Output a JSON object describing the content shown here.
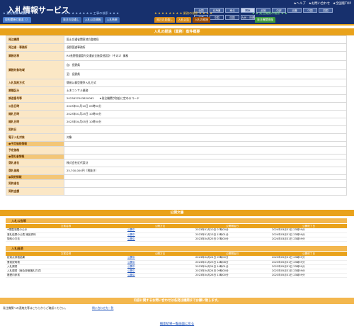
{
  "header": {
    "title": "入札情報サービス",
    "links": [
      "★ヘルプ",
      "★お問い合わせ",
      "★全国版TOP"
    ],
    "regions_row1": [
      "全国",
      "北海道",
      "東北",
      "関東",
      "北陸",
      "中部",
      "近畿",
      "中国",
      "四国",
      "九州・沖縄"
    ],
    "regions_row2": [
      "沖縄",
      "中国",
      "四国",
      "九州・沖縄"
    ],
    "selected_region": "関東",
    "groups": [
      {
        "title": "★ 契約関係の検索 ★",
        "tabs": [
          "契約関係の案本（）"
        ]
      },
      {
        "title": "★ ★ ★ ★ ★ ★ ★ ★ ★ 工事の検索 ★ ★ ★",
        "tabs": [
          "発注の見通し",
          "入札公告情報",
          "入札結果"
        ]
      },
      {
        "title": "★ ★ ★ ★ ★ ★ ★ ★ 業務の検索 ★ ★ ★ ★",
        "tabs": [
          "発注の見通し",
          "入札公告",
          "入札の経過"
        ]
      },
      {
        "title": "★ ★ 発注機関の検索 ★ ★",
        "tabs": [
          "発注機関情報"
        ]
      }
    ]
  },
  "main": {
    "title": "入札の経過（業務）案件概要",
    "rows": [
      {
        "label": "発注機関",
        "value": "国土交通省関東地方整備局"
      },
      {
        "label": "発注者・事務所",
        "value": "長野国道事務所"
      },
      {
        "label": "業務名称",
        "value": "R5長野国道管内交通安全施設他設計（その2）業務"
      },
      {
        "label": "業務対象地域",
        "value": "自：長野県"
      },
      {
        "label": "",
        "value": "至：長野県"
      },
      {
        "label": "入札契約方式",
        "value": "簡易公募型競争入札方式"
      },
      {
        "label": "業種区分",
        "value": "土木コンサル業務"
      },
      {
        "label": "調達番号等",
        "value": "2023837003820062　　★発注機関が独自に定めるコード"
      },
      {
        "label": "公告日時",
        "value": "2023年01月10日 09時00分"
      },
      {
        "label": "開札日時",
        "value": "2023年01月25日 10時00分"
      },
      {
        "label": "開札日時",
        "value": "2023年04月05日 10時00分"
      },
      {
        "label": "契約日",
        "value": ""
      },
      {
        "label": "電子入札対象",
        "value": "対象"
      }
    ],
    "sub1": "●予定価格情報",
    "sub1_rows": [
      {
        "label": "予定価格",
        "value": ""
      }
    ],
    "sub2": "●落札者情報",
    "sub2_rows": [
      {
        "label": "落札者名",
        "value": "株式会社近代設計"
      },
      {
        "label": "落札価格",
        "value": "25,700,000円（税抜き）"
      }
    ],
    "sub3": "●契約情報",
    "sub3_rows": [
      {
        "label": "契約者名",
        "value": ""
      },
      {
        "label": "契約金額",
        "value": ""
      }
    ]
  },
  "docs": {
    "title": "公開文書",
    "sections": [
      {
        "title": "入札公告等",
        "headers": [
          "文書名称",
          "公開方法",
          "公開開始日",
          "公開終了日"
        ],
        "rows": [
          [
            "※閲覧制限の公示",
            "公開中",
            "2023年01月10日 07時00分",
            "2024年03月31日 23時59分"
          ],
          [
            "落札結果の公表 適宜資料",
            "公開中",
            "2023年01月13日 15時01分",
            "2024年03月31日 23時59分"
          ],
          [
            "契約の方法",
            "公開中",
            "2023年04月25日 07時00分",
            "2024年03月31日 23時59分"
          ]
        ]
      },
      {
        "title": "入札経過",
        "headers": [
          "文書名称",
          "公開方法",
          "公開開始日",
          "公開終了日"
        ],
        "rows": [
          [
            "技術点評価結果",
            "公開中",
            "2023年04月24日 09時00分",
            "2023年05月31日 23時59分"
          ],
          [
            "業前説明書",
            "公開中",
            "2023年01月23日 14時08分",
            "2023年05月31日 23時59分"
          ],
          [
            "入札調書",
            "公開中",
            "2023年04月24日 14時01分",
            "2023年05月31日 23時59分"
          ],
          [
            "入札調書（総合評価落札方式）",
            "公開中",
            "2023年04月24日 09時00分",
            "2023年05月31日 23時59分"
          ],
          [
            "履歴内訳書",
            "公開中",
            "2023年04月28日 13時00分",
            "2023年05月31日 23時59分"
          ]
        ]
      }
    ]
  },
  "footer": {
    "contact_bar": "内容に関するお問い合わせは各発注機関までお願い致します。",
    "contact_text": "発注機関への連絡先等はこちらからご確認ください。",
    "contact_link": "問い合わせ先一覧",
    "back_link": "検索結果一覧画面に戻る"
  },
  "colors": {
    "navy": "#17306d",
    "orange": "#e9a21b",
    "light_orange": "#fbe7c5",
    "link": "#1a4fb8"
  }
}
